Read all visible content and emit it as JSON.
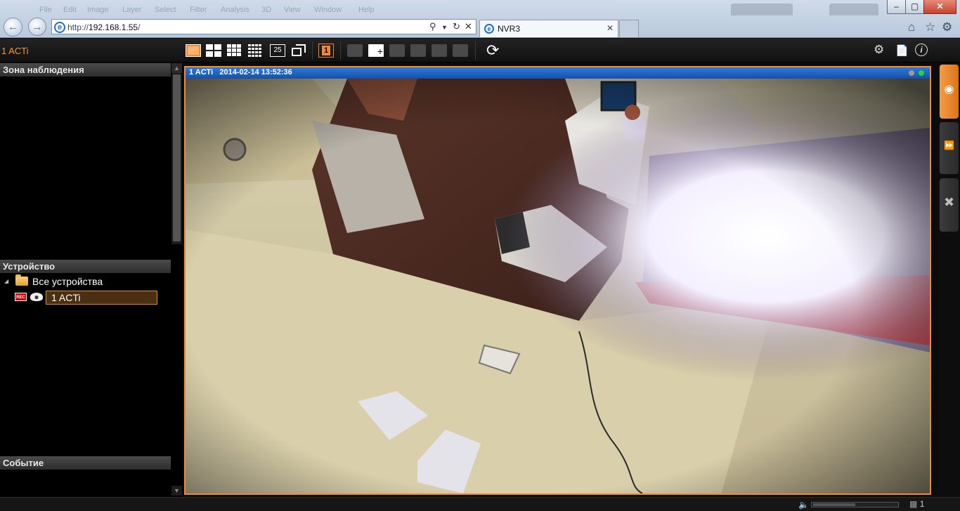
{
  "browser": {
    "menu_items": [
      "File",
      "Edit",
      "Image",
      "Layer",
      "Select",
      "Filter",
      "Analysis",
      "3D",
      "View",
      "Window",
      "Help"
    ],
    "address_prefix": "http://",
    "address_host": "192.168.1.55",
    "address_suffix": "/",
    "tab_title": "NVR3",
    "window_controls": {
      "minimize": "–",
      "maximize": "▢",
      "close": "✕"
    },
    "icons": [
      "back-icon",
      "forward-icon",
      "ie-logo-icon",
      "search-icon",
      "refresh-icon",
      "close-icon",
      "home-icon",
      "star-icon",
      "gear-icon"
    ]
  },
  "app": {
    "title": "1 ACTi",
    "toolbar": {
      "layout_count_label": "25",
      "live_channel": "1",
      "icons": [
        "single-view-icon",
        "grid-2x2-icon",
        "grid-3x3-icon",
        "grid-4x4-icon",
        "grid-5x5-icon",
        "sequence-icon",
        "live-view-icon",
        "add-view-icon",
        "refresh-icon",
        "settings-icon",
        "document-icon",
        "info-icon"
      ]
    }
  },
  "left_panel": {
    "surveillance_zone_header": "Зона наблюдения",
    "devices_header": "Устройство",
    "tree_root_label": "Все устройства",
    "device_rec_badge": "REC",
    "device_label": "1 ACTi",
    "events_header": "Событие"
  },
  "camera": {
    "name": "1 ACTi",
    "timestamp": "2014-02-14 13:52:36",
    "status_colors": {
      "gray": "#9a9a9a",
      "green": "#27d43a"
    }
  },
  "status_bar": {
    "connected_users": "1"
  },
  "colors": {
    "accent_orange": "#f08a30",
    "camera_bar_blue": "#1f63c0",
    "panel_black": "#000000"
  }
}
